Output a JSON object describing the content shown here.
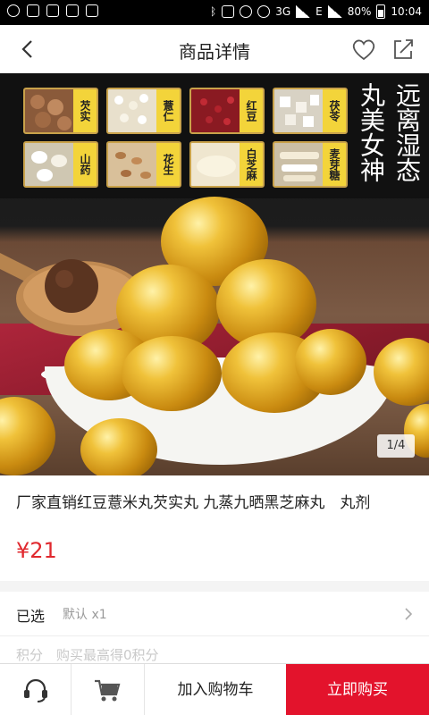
{
  "status_bar": {
    "battery_percent": "80%",
    "time": "10:04",
    "network": "3G",
    "signal_label": "E"
  },
  "header": {
    "title": "商品详情",
    "back_icon": "back-arrow-icon",
    "favorite_icon": "heart-icon",
    "share_icon": "share-icon"
  },
  "gallery": {
    "page_indicator": "1/4",
    "ingredients": [
      {
        "label": "芡实"
      },
      {
        "label": "薏仁"
      },
      {
        "label": "红豆"
      },
      {
        "label": "茯苓"
      },
      {
        "label": "山药"
      },
      {
        "label": "花生"
      },
      {
        "label": "白芝麻"
      },
      {
        "label": "麦芽糖"
      }
    ],
    "vertical_text_1": "远离湿态",
    "vertical_text_2": "丸美女神"
  },
  "product": {
    "title": "厂家直销红豆薏米丸芡实丸 九蒸九晒黑芝麻丸　丸剂",
    "price": "¥21"
  },
  "selection": {
    "label": "已选",
    "value": "默认 x1"
  },
  "partial_row_text": "积分　购买最高得0积分",
  "bottom_bar": {
    "add_to_cart": "加入购物车",
    "buy_now": "立即购买",
    "service_icon": "headset-icon",
    "cart_icon": "cart-icon"
  },
  "colors": {
    "accent_red": "#e3132c",
    "price_red": "#e0282e",
    "tag_yellow": "#f3d43a"
  }
}
